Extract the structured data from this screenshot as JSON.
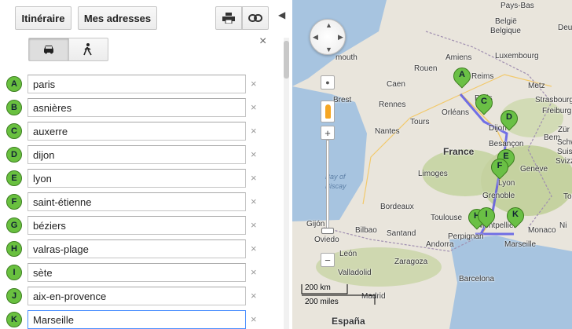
{
  "toolbar": {
    "itinerary_label": "Itinéraire",
    "addresses_label": "Mes adresses",
    "print_icon": "print-icon",
    "link_icon": "link-icon"
  },
  "modes": {
    "selected": "car",
    "car_icon": "car-icon",
    "walk_icon": "walk-icon"
  },
  "waypoints": [
    {
      "marker": "A",
      "value": "paris"
    },
    {
      "marker": "B",
      "value": "asnières"
    },
    {
      "marker": "C",
      "value": "auxerre"
    },
    {
      "marker": "D",
      "value": "dijon"
    },
    {
      "marker": "E",
      "value": "lyon"
    },
    {
      "marker": "F",
      "value": "saint-étienne"
    },
    {
      "marker": "G",
      "value": "béziers"
    },
    {
      "marker": "H",
      "value": "valras-plage"
    },
    {
      "marker": "I",
      "value": "sète"
    },
    {
      "marker": "J",
      "value": "aix-en-provence"
    },
    {
      "marker": "K",
      "value": "Marseille"
    }
  ],
  "remove_symbol": "×",
  "close_symbol": "×",
  "map": {
    "labels": {
      "pays_bas": "Pays-Bas",
      "belgique": "België",
      "belgique2": "Belgique",
      "luxembourg": "Luxembourg",
      "ger": "Deu",
      "plymouth": "mouth",
      "amiens": "Amiens",
      "rouen": "Rouen",
      "paris": "Paris",
      "reims": "Reims",
      "metz": "Metz",
      "strasbourg": "Strasbourg",
      "caen": "Caen",
      "rennes": "Rennes",
      "brest": "Brest",
      "orleans": "Orléans",
      "tours": "Tours",
      "nantes": "Nantes",
      "france": "France",
      "dijon": "Dijon",
      "besancon": "Besançon",
      "freiburg": "Freiburg im Breisgau",
      "zurich": "Zür",
      "bern": "Bern",
      "schweiz": "Schweiz",
      "suisse": "Suisse",
      "svizzera": "Svizz",
      "geneve": "Genève",
      "limoges": "Limoges",
      "lyon": "Lyon",
      "bordeaux": "Bordeaux",
      "grenoble": "Grenoble",
      "toulouse": "Toulouse",
      "montpellier": "Montpellier",
      "marseille": "Marseille",
      "monaco": "Monaco",
      "nice": "Ni",
      "torino": "Tori",
      "perpignan": "Perpignan",
      "bay": "Bay of",
      "biscay": "Biscay",
      "gijon": "Gijón",
      "oviedo": "Oviedo",
      "bilbao": "Bilbao",
      "santander": "Santand",
      "andorra": "Andorra",
      "zaragoza": "Zaragoza",
      "valladolid": "Valladolid",
      "barcelona": "Barcelona",
      "madrid": "Madrid",
      "espana": "España",
      "ca": "Ca",
      "st": "St",
      "brest2": "Brest",
      "leon": "León",
      "france2": "Fr"
    },
    "scale": {
      "km": "200 km",
      "miles": "200 miles"
    },
    "pins": [
      "A",
      "C",
      "D",
      "E",
      "F",
      "H",
      "I",
      "K"
    ],
    "pan_icon": "pan-control-icon",
    "zoom_home_icon": "zoom-home-icon",
    "pegman_icon": "pegman-icon",
    "zoom_in": "+",
    "zoom_out": "−"
  }
}
